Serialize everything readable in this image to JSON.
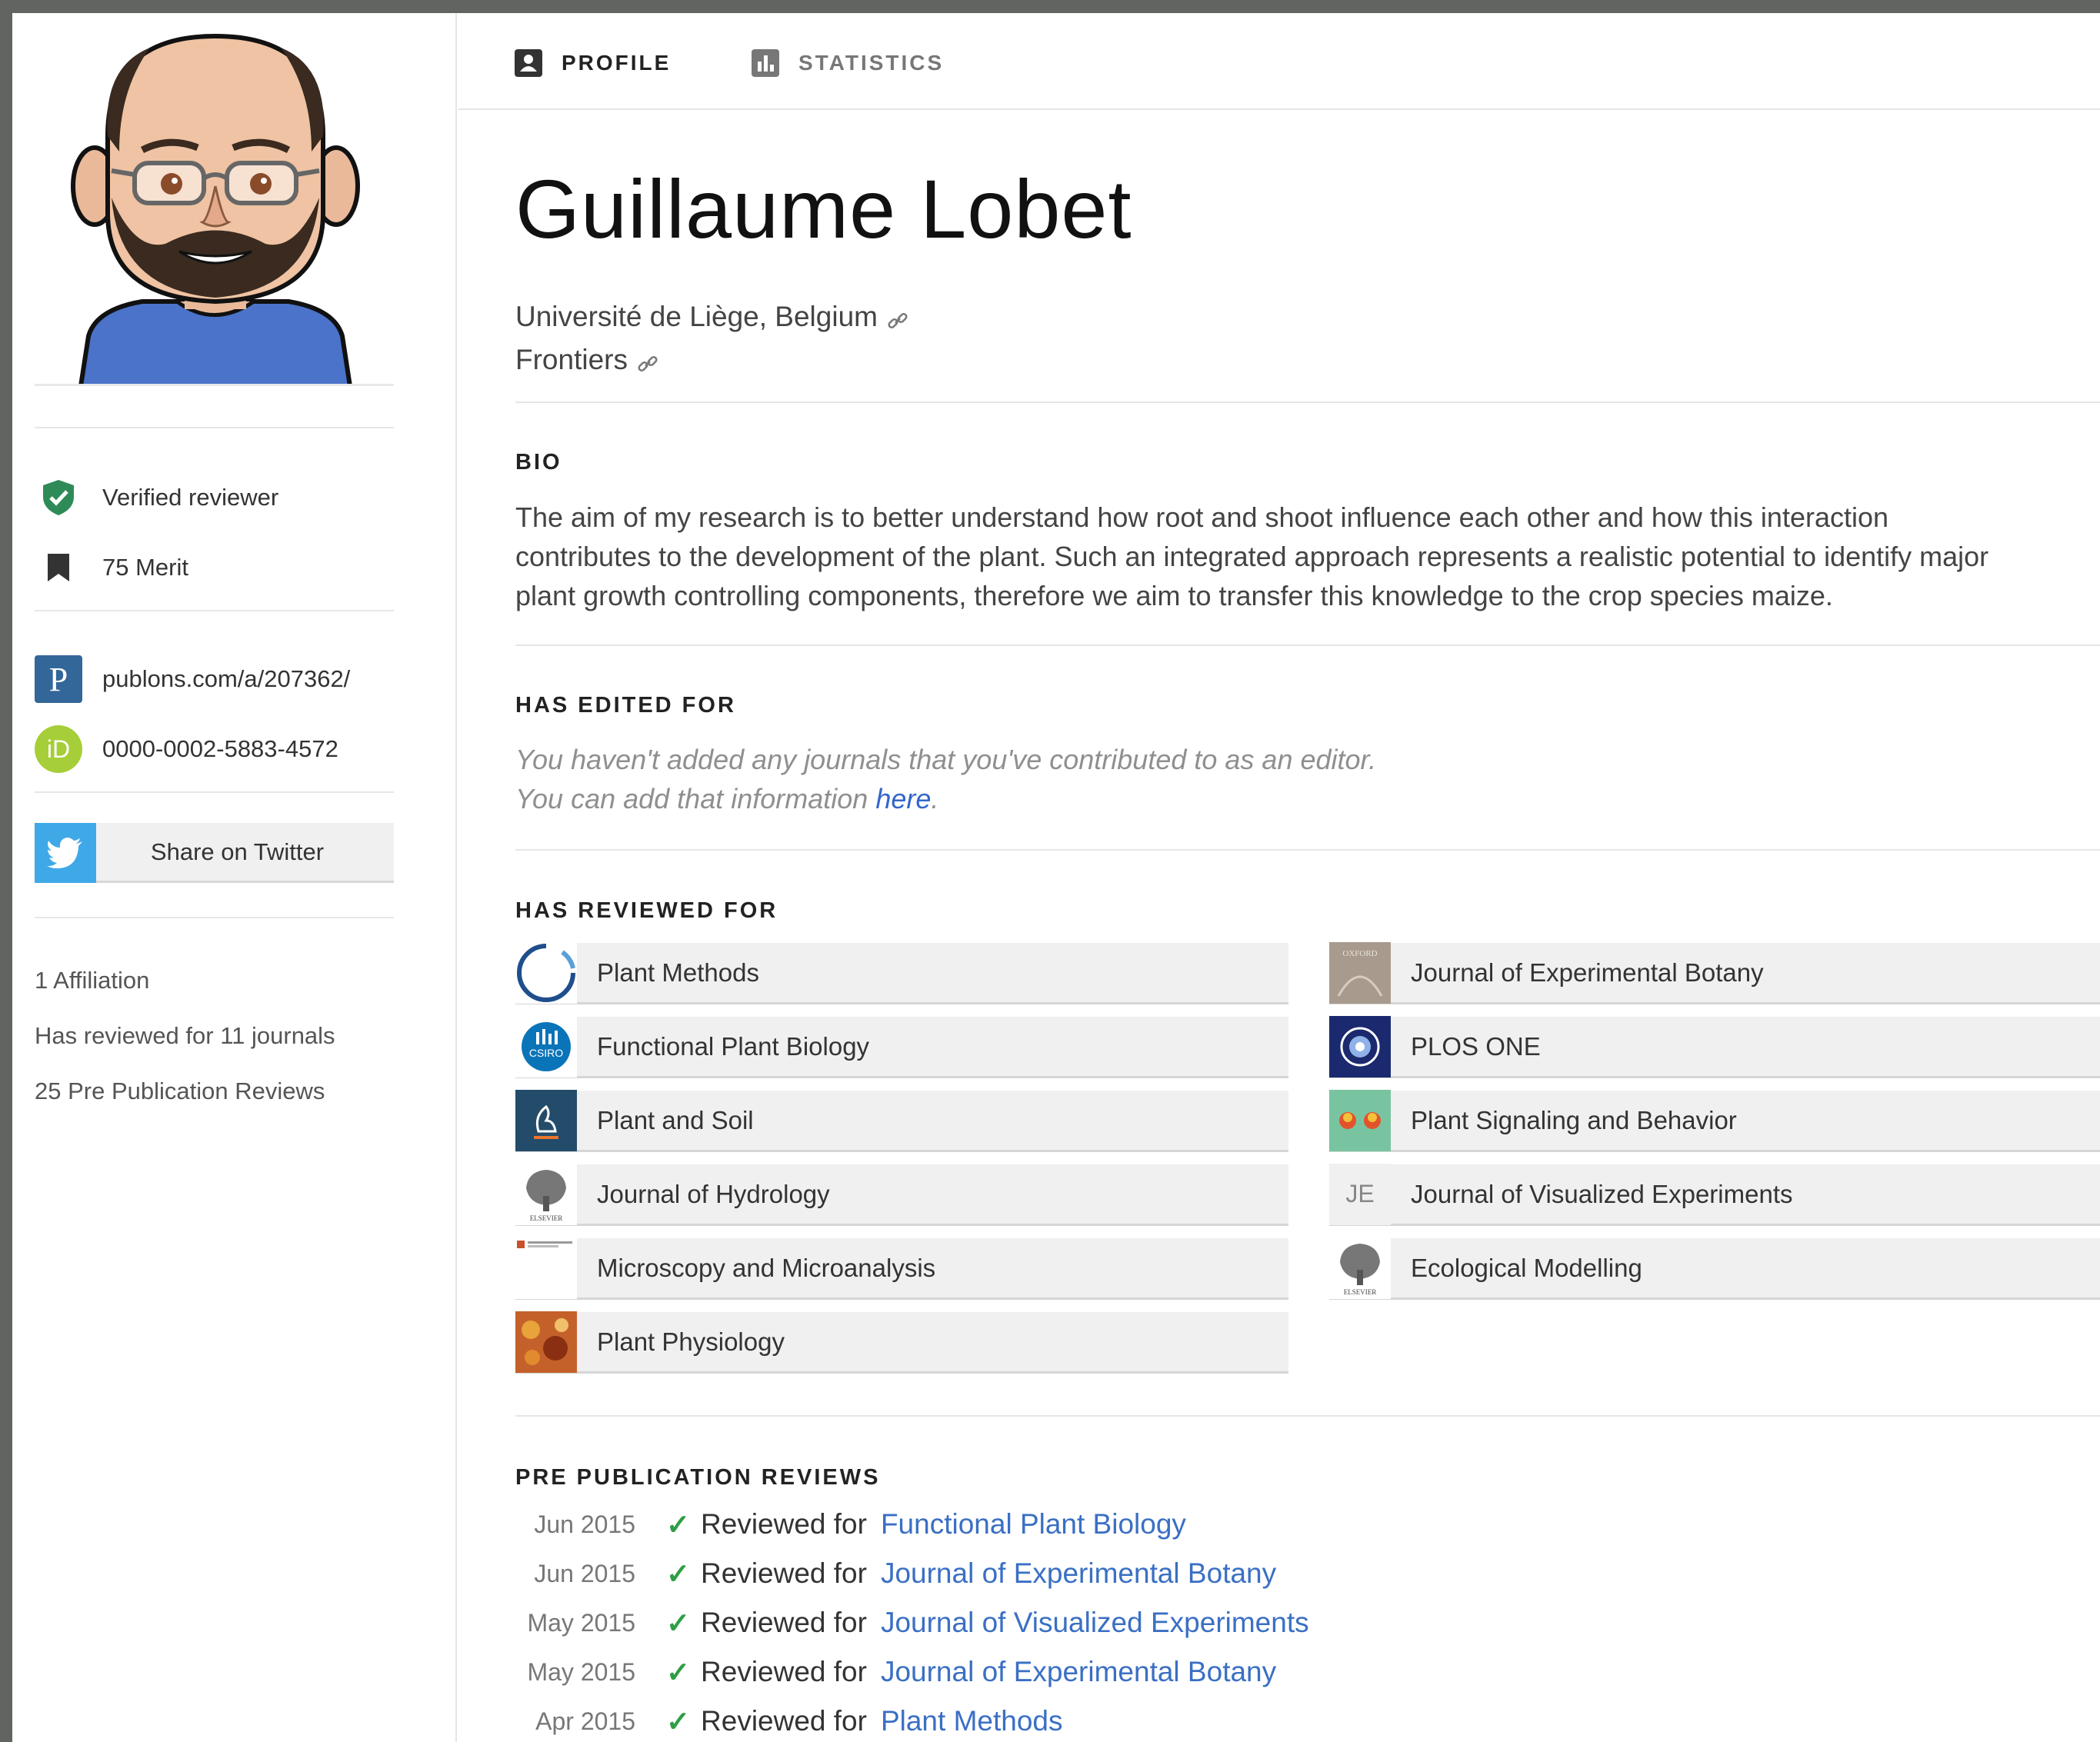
{
  "tabs": {
    "profile": "PROFILE",
    "statistics": "STATISTICS"
  },
  "profile": {
    "name": "Guillaume Lobet",
    "affiliations": [
      "Université de Liège, Belgium",
      "Frontiers"
    ]
  },
  "sidebar": {
    "verified": "Verified reviewer",
    "merit": "75 Merit",
    "publons": "publons.com/a/207362/",
    "orcid": "0000-0002-5883-4572",
    "orcid_logo": "iD",
    "publons_logo": "P",
    "twitter": "Share on Twitter",
    "stats": {
      "affiliation": "1 Affiliation",
      "reviewed": "Has reviewed for 11 journals",
      "prepub": "25 Pre Publication Reviews"
    }
  },
  "bio": {
    "title": "BIO",
    "text": "The aim of my research is to better understand how root and shoot influence each other and how this interaction contributes to the development of the plant. Such an integrated approach represents a realistic potential to identify major plant growth controlling components, therefore we aim to transfer this knowledge to the crop species maize."
  },
  "edited": {
    "title": "HAS EDITED FOR",
    "line1": "You haven't added any journals that you've contributed to as an editor.",
    "line2_prefix": "You can add that information ",
    "line2_link": "here",
    "line2_suffix": "."
  },
  "reviewed": {
    "title": "HAS REVIEWED FOR",
    "journals": [
      "Plant Methods",
      "Journal of Experimental Botany",
      "Functional Plant Biology",
      "PLOS ONE",
      "Plant and Soil",
      "Plant Signaling and Behavior",
      "Journal of Hydrology",
      "Journal of Visualized Experiments",
      "Microscopy and Microanalysis",
      "Ecological Modelling",
      "Plant Physiology"
    ],
    "logo_text": {
      "jove": "JE",
      "csiro": "CSIRO",
      "elsevier": "ELSEVIER",
      "oxford": "OXFORD"
    }
  },
  "prepub": {
    "title": "PRE PUBLICATION REVIEWS",
    "prefix": "Reviewed for",
    "check": "✓",
    "items": [
      {
        "date": "Jun 2015",
        "journal": "Functional Plant Biology"
      },
      {
        "date": "Jun 2015",
        "journal": "Journal of Experimental Botany"
      },
      {
        "date": "May 2015",
        "journal": "Journal of Visualized Experiments"
      },
      {
        "date": "May 2015",
        "journal": "Journal of Experimental Botany"
      },
      {
        "date": "Apr 2015",
        "journal": "Plant Methods"
      }
    ]
  },
  "colors": {
    "link": "#3a6fc4",
    "check": "#2e9e45",
    "verified_shield": "#2e8b57",
    "publons": "#336699",
    "orcid": "#a6ce39",
    "twitter": "#3fa9e8"
  },
  "icons": {
    "profile_tab": "id-card-icon",
    "statistics_tab": "bar-chart-icon",
    "verified": "shield-check-icon",
    "merit": "bookmark-icon",
    "affiliation_link": "link-icon",
    "twitter": "twitter-bird-icon"
  }
}
